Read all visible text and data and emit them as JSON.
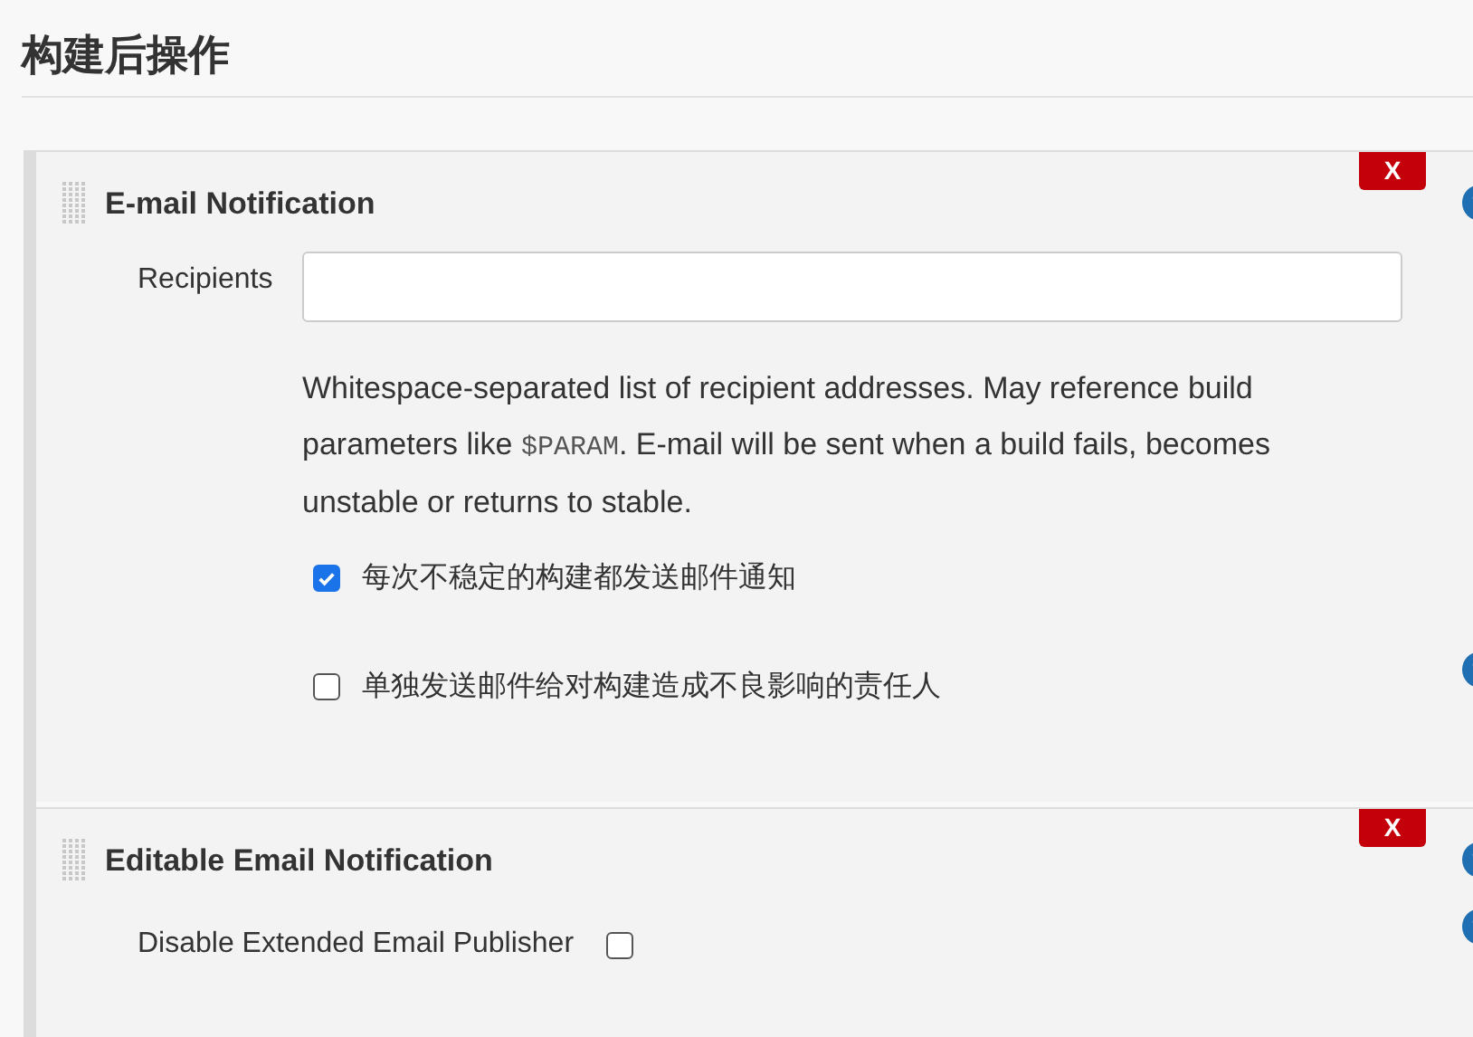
{
  "section_title": "构建后操作",
  "panels": [
    {
      "title": "E-mail Notification",
      "delete_label": "X",
      "help": true,
      "fields": [
        {
          "kind": "text_input",
          "label": "Recipients",
          "help": false,
          "description": [
            {
              "kind": "text",
              "text": "Whitespace-separated list of recipient addresses. May reference build parameters like "
            },
            {
              "kind": "code",
              "text": "$PARAM"
            },
            {
              "kind": "text",
              "text": ". E-mail will be sent when a build fails, becomes unstable or returns to stable."
            }
          ]
        },
        {
          "kind": "checkbox",
          "label": "每次不稳定的构建都发送邮件通知",
          "checked": true,
          "help": false
        },
        {
          "kind": "checkbox",
          "label": "单独发送邮件给对构建造成不良影响的责任人",
          "checked": false,
          "help": true
        }
      ]
    },
    {
      "title": "Editable Email Notification",
      "delete_label": "X",
      "help": true,
      "fields": [
        {
          "kind": "labeled_checkbox",
          "label": "Disable Extended Email Publisher",
          "checked": false,
          "help": true
        }
      ]
    }
  ]
}
